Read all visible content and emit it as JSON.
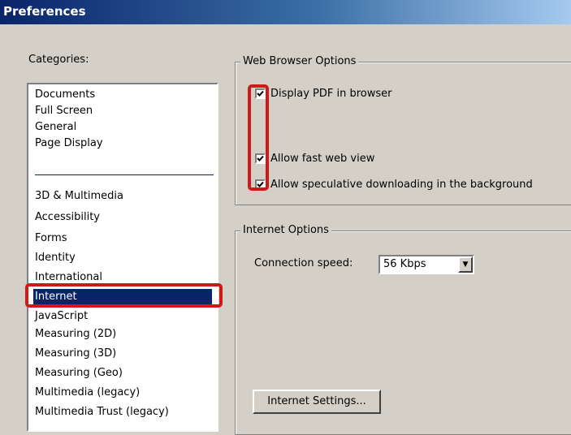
{
  "window": {
    "title": "Preferences"
  },
  "categories": {
    "label": "Categories:",
    "group1": [
      "Documents",
      "Full Screen",
      "General",
      "Page Display"
    ],
    "group2": [
      "3D & Multimedia",
      "Accessibility",
      "Forms",
      "Identity",
      "International",
      "Internet",
      "JavaScript",
      "Measuring (2D)",
      "Measuring (3D)",
      "Measuring (Geo)",
      "Multimedia (legacy)",
      "Multimedia Trust (legacy)"
    ],
    "selected": "Internet"
  },
  "web_browser_options": {
    "legend": "Web Browser Options",
    "display_pdf": {
      "label": "Display PDF in browser",
      "checked": true
    },
    "fast_web_view": {
      "label": "Allow fast web view",
      "checked": true
    },
    "speculative_download": {
      "label": "Allow speculative downloading in the background",
      "checked": true
    }
  },
  "internet_options": {
    "legend": "Internet Options",
    "connection_speed_label": "Connection speed:",
    "connection_speed_value": "56 Kbps",
    "settings_button": "Internet Settings..."
  },
  "highlight_color": "#d01818",
  "selection_color": "#0a246a"
}
